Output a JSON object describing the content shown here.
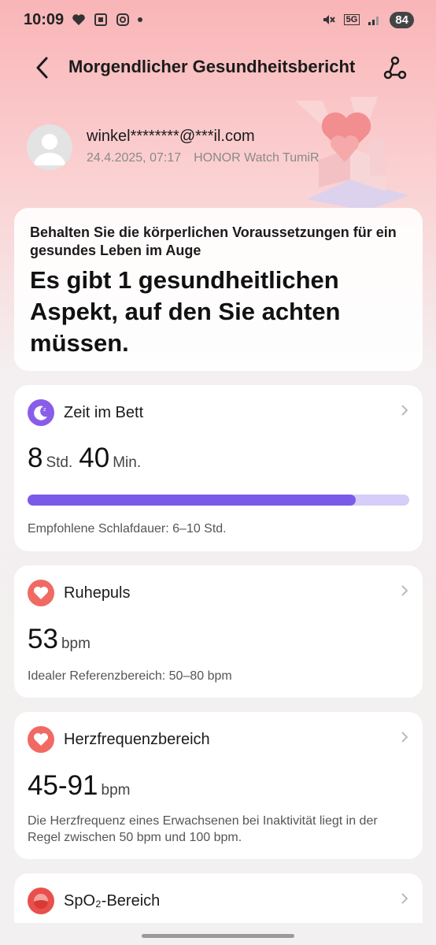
{
  "status_bar": {
    "time": "10:09",
    "battery": "84",
    "network": "5G"
  },
  "header": {
    "title": "Morgendlicher Gesundheitsbericht"
  },
  "user": {
    "email": "winkel********@***il.com",
    "date": "24.4.2025, 07:17",
    "device": "HONOR Watch TumiR"
  },
  "summary": {
    "subtitle": "Behalten Sie die körperlichen Voraussetzungen für ein gesundes Leben im Auge",
    "headline": "Es gibt 1 gesundheitlichen Aspekt, auf den Sie achten müssen."
  },
  "sleep": {
    "title": "Zeit im Bett",
    "hours": "8",
    "hours_unit": "Std.",
    "minutes": "40",
    "minutes_unit": "Min.",
    "progress_fraction": 0.86,
    "note": "Empfohlene Schlafdauer: 6–10 Std.",
    "accent_color": "#7b5ae8"
  },
  "resting_hr": {
    "title": "Ruhepuls",
    "value": "53",
    "unit": "bpm",
    "note": "Idealer Referenzbereich: 50–80 bpm"
  },
  "hr_range": {
    "title": "Herzfrequenzbereich",
    "value": "45-91",
    "unit": "bpm",
    "note": "Die Herzfrequenz eines Erwachsenen bei Inaktivität liegt in der Regel zwischen 50 bpm und 100 bpm."
  },
  "spo2": {
    "title": "SpO₂-Bereich"
  },
  "icons": [
    "back-arrow-icon",
    "share-icon",
    "heart-icon",
    "moon-icon",
    "chevron-right-icon",
    "avatar-icon"
  ]
}
